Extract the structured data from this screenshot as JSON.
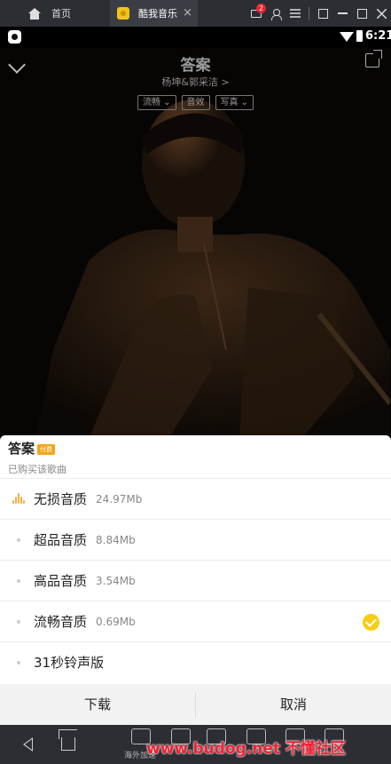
{
  "emulator": {
    "home_tab_label": "首页",
    "app_tab_label": "酷我音乐",
    "close_glyph": "×",
    "notification_count": "2"
  },
  "statusbar": {
    "time": "6:21"
  },
  "player": {
    "song_title": "答案",
    "artist": "杨坤&郭采洁 >",
    "pills": [
      "流畅 ⌄",
      "音效",
      "写真 ⌄"
    ]
  },
  "sheet": {
    "song_name": "答案",
    "song_tag": "付费",
    "purchased_note": "已购买该歌曲",
    "options": [
      {
        "name": "无损音质",
        "size": "24.97Mb",
        "selected": false,
        "playing": true
      },
      {
        "name": "超品音质",
        "size": "8.84Mb",
        "selected": false,
        "playing": false
      },
      {
        "name": "高品音质",
        "size": "3.54Mb",
        "selected": false,
        "playing": false
      },
      {
        "name": "流畅音质",
        "size": "0.69Mb",
        "selected": true,
        "playing": false
      },
      {
        "name": "31秒铃声版",
        "size": "",
        "selected": false,
        "playing": false
      }
    ],
    "download_label": "下载",
    "cancel_label": "取消"
  },
  "navbar": {
    "tool_labels": [
      "海外加速",
      "发现...",
      "...",
      "...",
      "..."
    ]
  },
  "watermark": "www.budog.net 不懂社区",
  "colors": {
    "accent": "#f7cd15",
    "chrome": "#2b2e33",
    "watermark": "#ee2233"
  }
}
